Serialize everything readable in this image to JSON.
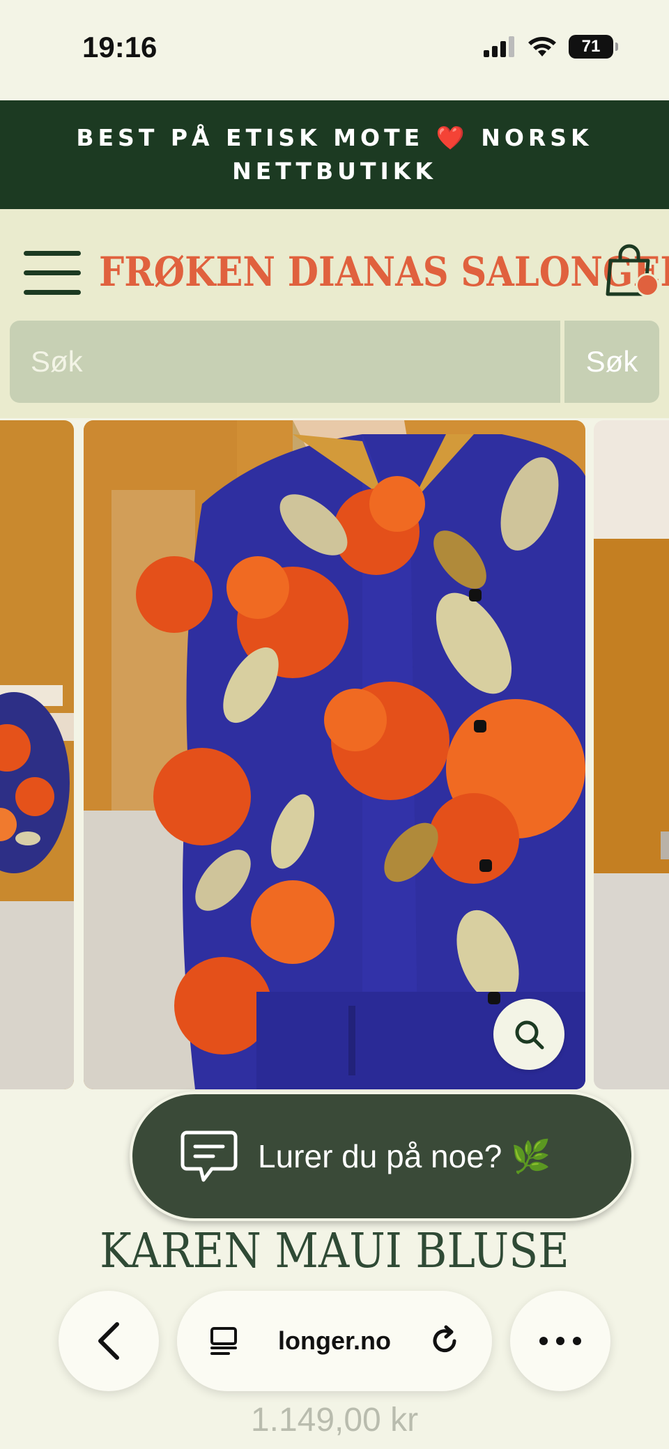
{
  "status_bar": {
    "time": "19:16",
    "battery": "71"
  },
  "announcement": {
    "text": "BEST PÅ ETISK MOTE ❤️ NORSK NETTBUTIKK"
  },
  "header": {
    "logo": "FRØKEN DIANAS SALONGER",
    "accent_color": "#e0613e",
    "dark_green": "#1c3a22"
  },
  "search": {
    "placeholder": "Søk",
    "button_label": "Søk"
  },
  "gallery": {
    "zoom_icon": "search-icon"
  },
  "chat": {
    "label": "Lurer du på noe? 🌿"
  },
  "product": {
    "title": "KAREN MAUI BLUSE",
    "price": "1.149,00 kr"
  },
  "browser": {
    "url": "longer.no"
  }
}
